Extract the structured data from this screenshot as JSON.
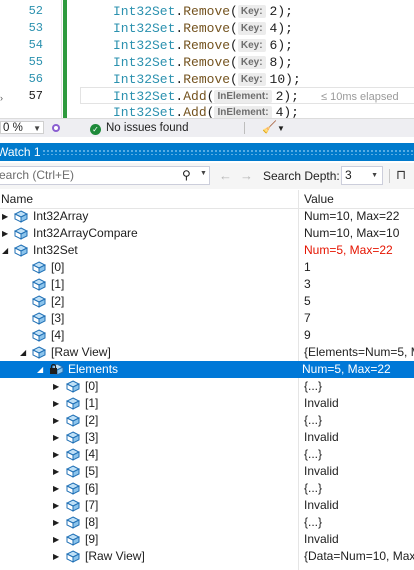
{
  "editor": {
    "lines": [
      {
        "num": "52",
        "type": "Int32Set",
        "method": "Remove",
        "param": "Key:",
        "arg": "2);"
      },
      {
        "num": "53",
        "type": "Int32Set",
        "method": "Remove",
        "param": "Key:",
        "arg": "4);"
      },
      {
        "num": "54",
        "type": "Int32Set",
        "method": "Remove",
        "param": "Key:",
        "arg": "6);"
      },
      {
        "num": "55",
        "type": "Int32Set",
        "method": "Remove",
        "param": "Key:",
        "arg": "8);"
      },
      {
        "num": "56",
        "type": "Int32Set",
        "method": "Remove",
        "param": "Key:",
        "arg": "10);"
      },
      {
        "num": "57",
        "type": "Int32Set",
        "method": "Add",
        "param": "InElement:",
        "arg": "2);"
      },
      {
        "num": "",
        "type": "Int32Set",
        "method": "Add",
        "param": "InElement:",
        "arg": "4);"
      }
    ],
    "elapsed": "≤ 10ms elapsed",
    "dot": "."
  },
  "status": {
    "zoom": "0 %",
    "issues": "No issues found"
  },
  "watch": {
    "title": "Watch 1",
    "search_placeholder": "earch (Ctrl+E)",
    "search_depth_label": "Search Depth:",
    "search_depth_value": "3",
    "columns": {
      "name": "Name",
      "value": "Value"
    },
    "rows": [
      {
        "name": "Int32Array",
        "value": "Num=10, Max=22"
      },
      {
        "name": "Int32ArrayCompare",
        "value": "Num=10, Max=10"
      },
      {
        "name": "Int32Set",
        "value": "Num=5, Max=22"
      },
      {
        "name": "[0]",
        "value": "1"
      },
      {
        "name": "[1]",
        "value": "3"
      },
      {
        "name": "[2]",
        "value": "5"
      },
      {
        "name": "[3]",
        "value": "7"
      },
      {
        "name": "[4]",
        "value": "9"
      },
      {
        "name": "[Raw View]",
        "value": "{Elements=Num=5, M"
      },
      {
        "name": "Elements",
        "value": "Num=5, Max=22"
      },
      {
        "name": "[0]",
        "value": "{...}"
      },
      {
        "name": "[1]",
        "value": "Invalid"
      },
      {
        "name": "[2]",
        "value": "{...}"
      },
      {
        "name": "[3]",
        "value": "Invalid"
      },
      {
        "name": "[4]",
        "value": "{...}"
      },
      {
        "name": "[5]",
        "value": "Invalid"
      },
      {
        "name": "[6]",
        "value": "{...}"
      },
      {
        "name": "[7]",
        "value": "Invalid"
      },
      {
        "name": "[8]",
        "value": "{...}"
      },
      {
        "name": "[9]",
        "value": "Invalid"
      },
      {
        "name": "[Raw View]",
        "value": "{Data=Num=10, Max"
      }
    ]
  },
  "colors": {
    "accent": "#007acc",
    "selection": "#0078d7",
    "changed_value": "#e51400",
    "code_type": "#2b91af",
    "code_method": "#74531f",
    "change_bar": "#2e9a3e"
  }
}
